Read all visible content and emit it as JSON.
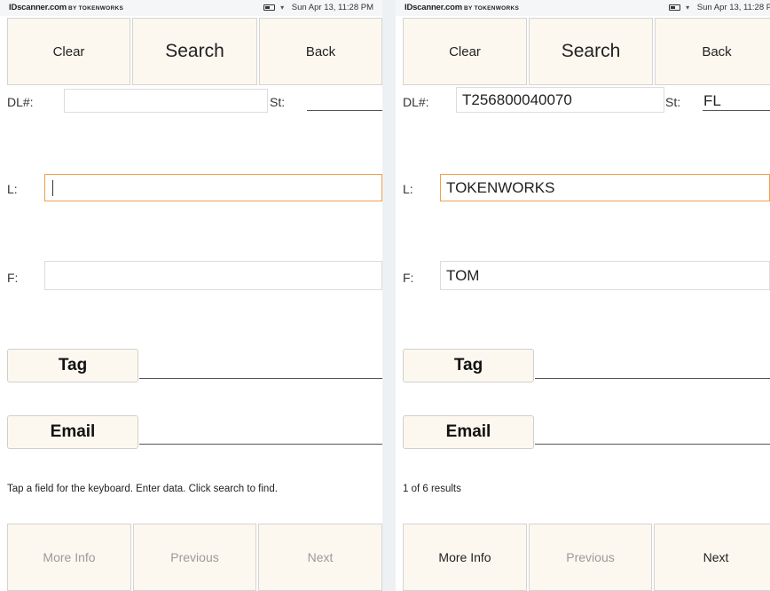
{
  "statusbar": {
    "brand": "IDscanner.com",
    "brand_by": "BY TOKENWORKS",
    "datetime": "Sun Apr 13, 11:28 PM",
    "battery_icon": "battery-icon",
    "wifi_icon": "wifi-icon"
  },
  "left": {
    "buttons": {
      "clear": "Clear",
      "search": "Search",
      "back": "Back"
    },
    "labels": {
      "dl": "DL#:",
      "st": "St:",
      "l": "L:",
      "f": "F:"
    },
    "values": {
      "dl": "",
      "st": "",
      "l": "",
      "f": ""
    },
    "tag": "Tag",
    "email": "Email",
    "message": "Tap a field for the keyboard. Enter data. Click search to find.",
    "bottom": {
      "more_info": "More Info",
      "previous": "Previous",
      "next": "Next"
    }
  },
  "right": {
    "buttons": {
      "clear": "Clear",
      "search": "Search",
      "back": "Back"
    },
    "labels": {
      "dl": "DL#:",
      "st": "St:",
      "l": "L:",
      "f": "F:"
    },
    "values": {
      "dl": "T256800040070",
      "st": "FL",
      "l": "TOKENWORKS",
      "f": "TOM"
    },
    "tag": "Tag",
    "email": "Email",
    "message": "1 of 6 results",
    "bottom": {
      "more_info": "More Info",
      "previous": "Previous",
      "next": "Next"
    }
  },
  "colors": {
    "button_bg": "#fdf8ef",
    "active_field_border": "#f0a04b",
    "disabled_text": "#9a9a9a"
  }
}
